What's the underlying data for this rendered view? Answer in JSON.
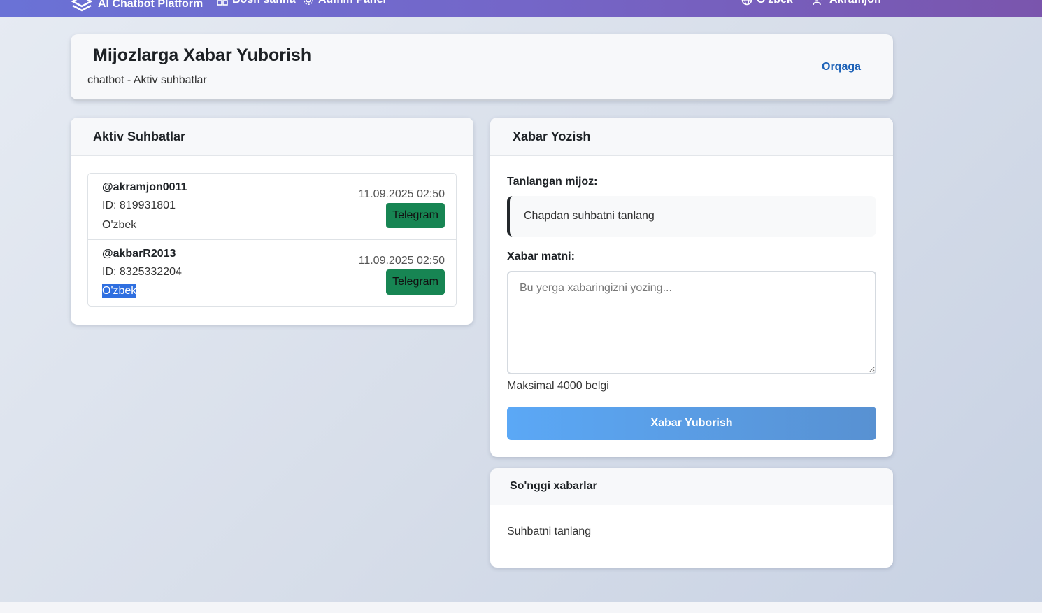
{
  "navbar": {
    "brand": "AI Chatbot Platform",
    "links": [
      {
        "label": "Bosh sahifa",
        "icon": "grid-icon"
      },
      {
        "label": "Admin Panel",
        "icon": "gear-icon"
      }
    ],
    "language": {
      "label": "O'zbek",
      "icon": "globe-icon"
    },
    "user": {
      "label": "Akramjon",
      "icon": "user-icon"
    }
  },
  "header": {
    "title": "Mijozlarga Xabar Yuborish",
    "subtitle": "chatbot - Aktiv suhbatlar",
    "back_label": "Orqaga"
  },
  "conversations": {
    "title": "Aktiv Suhbatlar",
    "items": [
      {
        "username": "@akramjon0011",
        "id": "ID: 819931801",
        "language": "O'zbek",
        "date": "11.09.2025 02:50",
        "platform": "Telegram"
      },
      {
        "username": "@akbarR2013",
        "id": "ID: 8325332204",
        "language": "O'zbek",
        "date": "11.09.2025 02:50",
        "platform": "Telegram"
      }
    ]
  },
  "compose": {
    "title": "Xabar Yozish",
    "selected_label": "Tanlangan mijoz:",
    "selected_placeholder": "Chapdan suhbatni tanlang",
    "message_label": "Xabar matni:",
    "message_placeholder": "Bu yerga xabaringizni yozing...",
    "hint": "Maksimal 4000 belgi",
    "send_label": "Xabar Yuborish"
  },
  "recent": {
    "title": "So'nggi xabarlar",
    "empty": "Suhbatni tanlang"
  },
  "colors": {
    "navbar_start": "#6a72d6",
    "navbar_end": "#7a55ad",
    "telegram_badge": "#178553",
    "link": "#1e63b8",
    "send_button": "#5ba8f6"
  }
}
